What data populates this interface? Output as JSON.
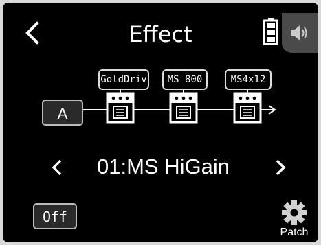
{
  "header": {
    "title": "Effect"
  },
  "chain": {
    "input_label": "A",
    "effects": [
      {
        "name": "GoldDriv"
      },
      {
        "name": "MS 800"
      },
      {
        "name": "MS4x12"
      }
    ]
  },
  "patch": {
    "name": "01:MS HiGain"
  },
  "footer": {
    "off_label": "Off",
    "patch_label": "Patch"
  },
  "colors": {
    "background": "#000000",
    "text": "#ffffff",
    "battery": "#ffffff",
    "tab": "#4a4a4a"
  },
  "icons": {
    "back": "chevron-left-icon",
    "battery": "battery-icon",
    "speaker": "speaker-icon",
    "settings": "gear-icon"
  }
}
